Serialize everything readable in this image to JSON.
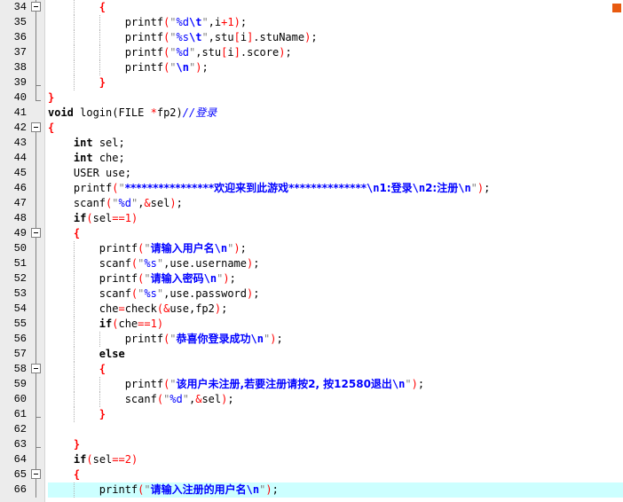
{
  "editor": {
    "line_numbers": [
      "34",
      "35",
      "36",
      "37",
      "38",
      "39",
      "40",
      "41",
      "42",
      "43",
      "44",
      "45",
      "46",
      "47",
      "48",
      "49",
      "50",
      "51",
      "52",
      "53",
      "54",
      "55",
      "56",
      "57",
      "58",
      "59",
      "60",
      "61",
      "62",
      "63",
      "64",
      "65",
      "66"
    ],
    "current_line": "66",
    "lines": {
      "l34": {
        "b": "{"
      },
      "l35": {
        "fn": "printf",
        "p1": "(",
        "s1": "\"",
        "f1": "%d",
        "e1": "\\t",
        "s2": "\"",
        "c1": ",",
        "v1": "i",
        "o1": "+",
        "n1": "1",
        "p2": ")",
        "sc": ";"
      },
      "l36": {
        "fn": "printf",
        "p1": "(",
        "s1": "\"",
        "f1": "%s",
        "e1": "\\t",
        "s2": "\"",
        "c1": ",",
        "v1": "stu",
        "o1": "[",
        "v2": "i",
        "o2": "]",
        "v3": ".stuName",
        "p2": ")",
        "sc": ";"
      },
      "l37": {
        "fn": "printf",
        "p1": "(",
        "s1": "\"",
        "f1": "%d",
        "s2": "\"",
        "c1": ",",
        "v1": "stu",
        "o1": "[",
        "v2": "i",
        "o2": "]",
        "v3": ".score",
        "p2": ")",
        "sc": ";"
      },
      "l38": {
        "fn": "printf",
        "p1": "(",
        "s1": "\"",
        "e1": "\\n",
        "s2": "\"",
        "p2": ")",
        "sc": ";"
      },
      "l39": {
        "b": "}"
      },
      "l40": {
        "b": "}"
      },
      "l41": {
        "kw": "void",
        "rest": " login(FILE ",
        "op": "*",
        "rest2": "fp2)",
        "cmt": "//登录"
      },
      "l42": {
        "b": "{"
      },
      "l43": {
        "kw": "int",
        "rest": " sel;"
      },
      "l44": {
        "kw": "int",
        "rest": " che;"
      },
      "l45": {
        "rest": "USER use;"
      },
      "l46": {
        "fn": "printf",
        "p1": "(",
        "s1": "\"",
        "t1": "****************欢迎来到此游戏**************",
        "e1": "\\n",
        "t2": "1:登录",
        "e2": "\\n",
        "t3": "2:注册",
        "e3": "\\n",
        "s2": "\"",
        "p2": ")",
        "sc": ";"
      },
      "l47": {
        "fn": "scanf",
        "p1": "(",
        "s1": "\"",
        "f1": "%d",
        "s2": "\"",
        "c1": ",",
        "o1": "&",
        "v1": "sel",
        "p2": ")",
        "sc": ";"
      },
      "l48": {
        "kw": "if",
        "p1": "(",
        "v1": "sel",
        "o1": "==",
        "n1": "1",
        "p2": ")"
      },
      "l49": {
        "b": "{"
      },
      "l50": {
        "fn": "printf",
        "p1": "(",
        "s1": "\"",
        "t1": "请输入用户名",
        "e1": "\\n",
        "s2": "\"",
        "p2": ")",
        "sc": ";"
      },
      "l51": {
        "fn": "scanf",
        "p1": "(",
        "s1": "\"",
        "f1": "%s",
        "s2": "\"",
        "c1": ",",
        "v1": "use.username",
        "p2": ")",
        "sc": ";"
      },
      "l52": {
        "fn": "printf",
        "p1": "(",
        "s1": "\"",
        "t1": "请输入密码",
        "e1": "\\n",
        "s2": "\"",
        "p2": ")",
        "sc": ";"
      },
      "l53": {
        "fn": "scanf",
        "p1": "(",
        "s1": "\"",
        "f1": "%s",
        "s2": "\"",
        "c1": ",",
        "v1": "use.password",
        "p2": ")",
        "sc": ";"
      },
      "l54": {
        "v1": "che",
        "o1": "=",
        "v2": "check",
        "p1": "(",
        "o2": "&",
        "v3": "use,fp2",
        "p2": ")",
        "sc": ";"
      },
      "l55": {
        "kw": "if",
        "p1": "(",
        "v1": "che",
        "o1": "==",
        "n1": "1",
        "p2": ")"
      },
      "l56": {
        "fn": "printf",
        "p1": "(",
        "s1": "\"",
        "t1": "恭喜你登录成功",
        "e1": "\\n",
        "s2": "\"",
        "p2": ")",
        "sc": ";"
      },
      "l57": {
        "kw": "else"
      },
      "l58": {
        "b": "{"
      },
      "l59": {
        "fn": "printf",
        "p1": "(",
        "s1": "\"",
        "t1": "该用户未注册,若要注册请按2, 按12580退出",
        "e1": "\\n",
        "s2": "\"",
        "p2": ")",
        "sc": ";"
      },
      "l60": {
        "fn": "scanf",
        "p1": "(",
        "s1": "\"",
        "f1": "%d",
        "s2": "\"",
        "c1": ",",
        "o1": "&",
        "v1": "sel",
        "p2": ")",
        "sc": ";"
      },
      "l61": {
        "b": "}"
      },
      "l63": {
        "b": "}"
      },
      "l64": {
        "kw": "if",
        "p1": "(",
        "v1": "sel",
        "o1": "==",
        "n1": "2",
        "p2": ")"
      },
      "l65": {
        "b": "{"
      },
      "l66": {
        "fn": "printf",
        "p1": "(",
        "s1": "\"",
        "t1": "请输入注册的用户名",
        "e1": "\\n",
        "s2": "\"",
        "p2": ")",
        "sc": ";"
      }
    }
  }
}
